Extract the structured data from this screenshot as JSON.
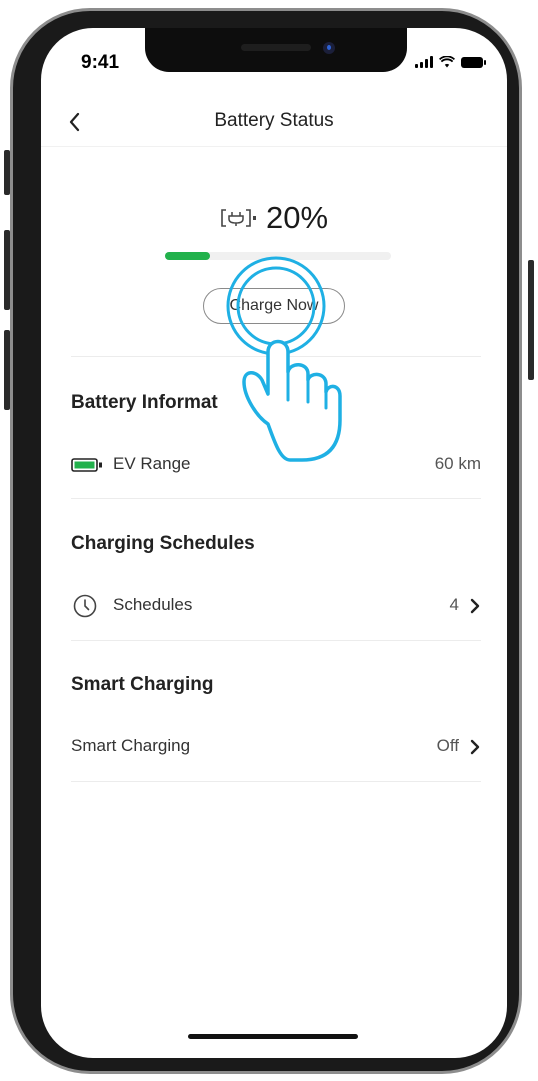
{
  "status_bar": {
    "time": "9:41"
  },
  "header": {
    "title": "Battery Status"
  },
  "battery": {
    "percent_label": "20%",
    "charge_level": 0.2,
    "charge_button_label": "Charge Now"
  },
  "battery_info": {
    "title": "Battery Informat",
    "ev_range_label": "EV Range",
    "ev_range_value": "60 km"
  },
  "charging_schedules": {
    "title": "Charging Schedules",
    "schedules_label": "Schedules",
    "schedules_count": "4"
  },
  "smart_charging": {
    "title": "Smart Charging",
    "row_label": "Smart Charging",
    "row_value": "Off"
  },
  "colors": {
    "progress_fill": "#22b14c",
    "hand_accent": "#1fb0e4",
    "frame": "#1a1a1a"
  },
  "icons": {
    "back": "chevron-left-icon",
    "plug": "charging-plug-icon",
    "ev_battery": "ev-battery-icon",
    "clock": "clock-icon",
    "chevron": "chevron-right-icon",
    "hand": "tap-gesture-hand-icon"
  }
}
